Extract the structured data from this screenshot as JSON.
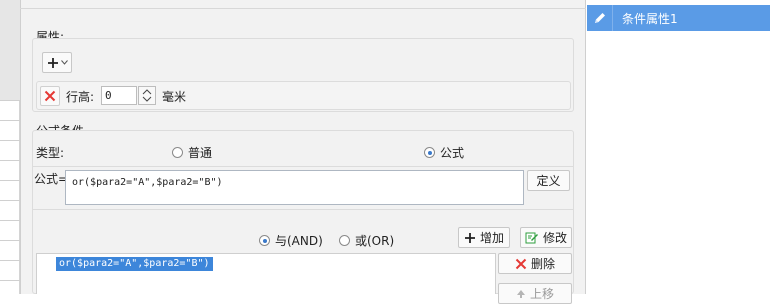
{
  "properties": {
    "title": "属性:",
    "row_height_label": "行高:",
    "row_height_value": "0",
    "unit": "毫米"
  },
  "formula_condition": {
    "title": "公式条件",
    "type_label": "类型:",
    "type_option_normal": "普通",
    "type_option_formula": "公式",
    "formula_label": "公式=",
    "formula_value": "or($para2=\"A\",$para2=\"B\")",
    "define_button": "定义",
    "logic_and": "与(AND)",
    "logic_or": "或(OR)",
    "add_button": "增加",
    "modify_button": "修改",
    "delete_button": "删除",
    "move_up_button": "上移",
    "conditions": [
      "or($para2=\"A\",$para2=\"B\")"
    ]
  },
  "right_panel": {
    "item_label": "条件属性1"
  },
  "colors": {
    "accent": "#5a9be6",
    "selection": "#3d86da",
    "delete_red": "#e53935",
    "modify_green": "#2e9e3e"
  }
}
